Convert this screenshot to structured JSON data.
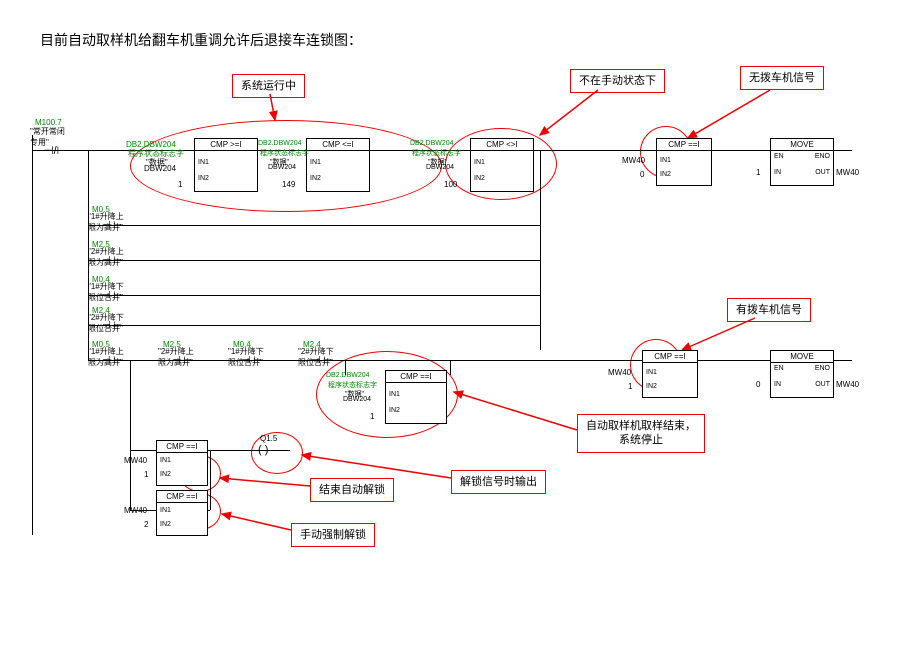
{
  "title": "目前自动取样机给翻车机重调允许后退接车连锁图：",
  "annotations": {
    "sysRunning": "系统运行中",
    "notManual": "不在手动状态下",
    "noCarSig": "无拨车机信号",
    "hasCarSig": "有拨车机信号",
    "sampleEnd": "自动取样机取样结束，\n系统停止",
    "endUnlock": "结束自动解锁",
    "manualUnlock": "手动强制解锁",
    "unlockOut": "解锁信号时输出"
  },
  "contacts": {
    "m100_7": {
      "addr": "M100.7",
      "name": "\"常开常闭\n专用\""
    },
    "m0_5": {
      "addr": "M0.5",
      "name": "\"1#升降上\n限为高并\""
    },
    "m2_5": {
      "addr": "M2.5",
      "name": "\"2#升降上\n限为高并\""
    },
    "m0_4": {
      "addr": "M0.4",
      "name": "\"1#升降下\n限位合并\""
    },
    "m2_4": {
      "addr": "M2.4",
      "name": "\"2#升降下\n限位合并\""
    },
    "m0_5b": {
      "addr": "M0.5",
      "name": "\"1#升降上\n限为高并\""
    },
    "m2_5b": {
      "addr": "M2.5",
      "name": "\"2#升降上\n限为高并\""
    },
    "m0_4b": {
      "addr": "M0.4",
      "name": "\"1#升降下\n限位合并\""
    },
    "m2_4b": {
      "addr": "M2.4",
      "name": "\"2#升降下\n限位合并\""
    }
  },
  "blocks": {
    "cmp_ge": "CMP >=I",
    "cmp_le": "CMP <=I",
    "cmp_eq": "CMP ==I",
    "cmp_ne": "CMP <>I",
    "move": "MOVE",
    "db2": "DB2.DBW204",
    "prog": "程序状态标志字",
    "data": "\"数据\"",
    "dbw204": "DBW204",
    "in1": "IN1",
    "in2": "IN2",
    "in": "IN",
    "out": "OUT",
    "en": "EN",
    "eno": "ENO",
    "v1": "1",
    "v149": "149",
    "v100": "100",
    "v0": "0",
    "v2": "2",
    "mw40": "MW40",
    "q1_5": "Q1.5",
    "paren": "(   )"
  }
}
